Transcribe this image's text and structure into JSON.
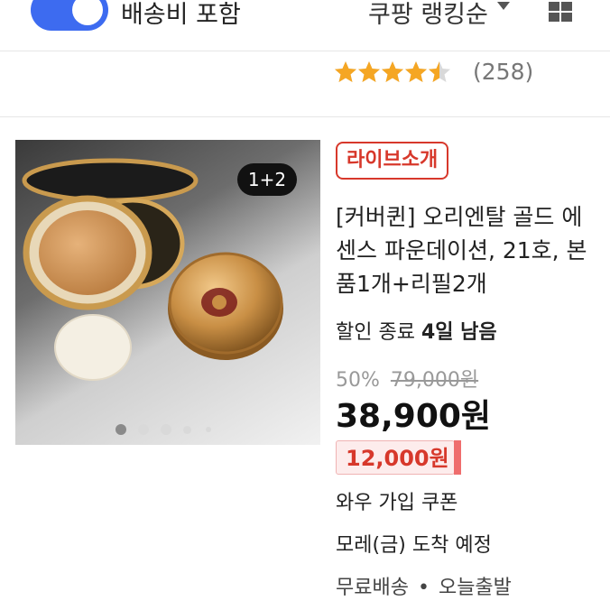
{
  "filter_bar": {
    "shipping_toggle_label": "배송비 포함",
    "shipping_toggle_on": true,
    "sort_label": "쿠팡 랭킹순",
    "accent_color": "#3d6bf0"
  },
  "rating": {
    "stars": 4.5,
    "max_stars": 5,
    "review_count": "(258)",
    "star_color": "#f5a623"
  },
  "product": {
    "image_badge": "1+2",
    "carousel_total": 5,
    "carousel_active": 1,
    "live_tag": "라이브소개",
    "title": "[커버퀸] 오리엔탈 골드 에센스 파운데이션, 21호, 본품1개+리필2개",
    "timer_prefix": "할인 종료",
    "timer_value": "4일 남음",
    "discount_rate": "50%",
    "original_price": "79,000원",
    "price": "38,900원",
    "coupon_amount": "12,000원",
    "coupon_text": "와우 가입 쿠폰",
    "arrival": "모레(금) 도착 예정",
    "shipping_free": "무료배송",
    "shipping_today": "오늘출발",
    "brand_red": "#d7382b"
  }
}
